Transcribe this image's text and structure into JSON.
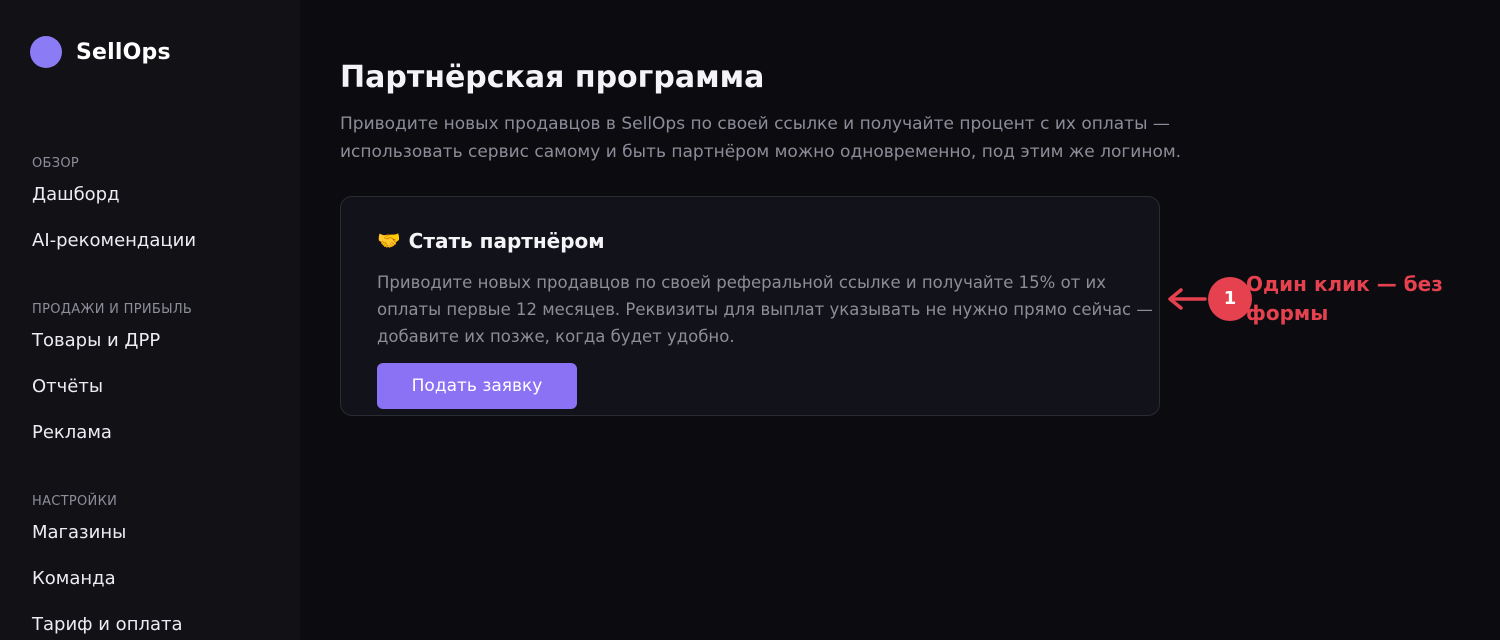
{
  "sidebar": {
    "brand": "SellOps",
    "sections": [
      {
        "heading": "ОБЗОР",
        "items": [
          "Дашборд",
          "AI-рекомендации"
        ]
      },
      {
        "heading": "ПРОДАЖИ И ПРИБЫЛЬ",
        "items": [
          "Товары и ДРР",
          "Отчёты",
          "Реклама"
        ]
      },
      {
        "heading": "НАСТРОЙКИ",
        "items": [
          "Магазины",
          "Команда",
          "Тариф и оплата"
        ]
      }
    ]
  },
  "main": {
    "title": "Партнёрская программа",
    "description": "Приводите новых продавцов в SellOps по своей ссылке и получайте процент с их оплаты — использовать сервис самому и быть партнёром можно одновременно, под этим же логином.",
    "card": {
      "icon": "handshake-icon",
      "title": "Стать партнёром",
      "description": "Приводите новых продавцов по своей реферальной ссылке и получайте 15% от их оплаты первые 12 месяцев. Реквизиты для выплат указывать не нужно прямо сейчас — добавите их позже, когда будет удобно.",
      "button_label": "Подать заявку"
    }
  },
  "annotation": {
    "badge": "1",
    "text": "Один клик — без формы",
    "color": "#e5414f"
  },
  "colors": {
    "accent": "#8b72f5",
    "brand_dot": "#8b7cf6",
    "background": "#0b0b10",
    "sidebar": "#111116"
  }
}
